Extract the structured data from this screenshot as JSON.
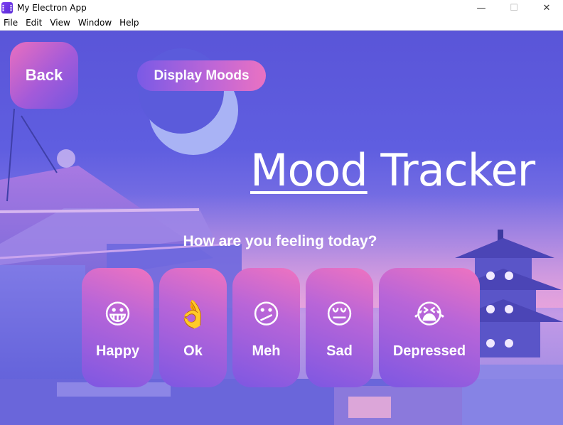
{
  "window": {
    "title": "My Electron App",
    "icon_name": "electron-app-icon",
    "minimize": "—",
    "maximize": "☐",
    "close": "✕"
  },
  "menu": [
    "File",
    "Edit",
    "View",
    "Window",
    "Help"
  ],
  "nav": {
    "back_label": "Back",
    "display_moods_label": "Display Moods"
  },
  "heading": {
    "part1": "Mood",
    "part2": " Tracker"
  },
  "prompt": "How are you feeling today?",
  "moods": [
    {
      "label": "Happy",
      "emoji": "😀",
      "icon": "grinning-face-icon"
    },
    {
      "label": "Ok",
      "emoji": "👌",
      "icon": "ok-hand-icon"
    },
    {
      "label": "Meh",
      "emoji": "😕",
      "icon": "confused-face-icon"
    },
    {
      "label": "Sad",
      "emoji": "😔",
      "icon": "pensive-face-icon"
    },
    {
      "label": "Depressed",
      "emoji": "😭",
      "icon": "crying-face-icon"
    }
  ],
  "colors": {
    "accent_pink": "#ea6fbf",
    "accent_purple": "#7357e0",
    "background": "#5f5ee0"
  }
}
